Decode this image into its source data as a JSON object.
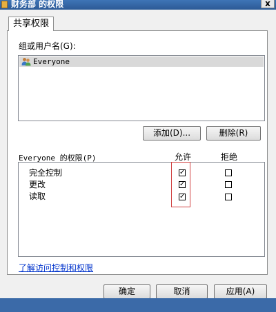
{
  "window": {
    "title": "财务部 的权限",
    "close_glyph": "x"
  },
  "tabs": [
    {
      "label": "共享权限"
    }
  ],
  "group_users": {
    "label": "组或用户名(G):",
    "items": [
      {
        "name": "Everyone",
        "selected": true
      }
    ]
  },
  "buttons": {
    "add": "添加(D)...",
    "remove": "删除(R)",
    "ok": "确定",
    "cancel": "取消",
    "apply": "应用(A)"
  },
  "permissions": {
    "header_label": "Everyone 的权限(P)",
    "allow_header": "允许",
    "deny_header": "拒绝",
    "rows": [
      {
        "name": "完全控制",
        "allow": true,
        "deny": false
      },
      {
        "name": "更改",
        "allow": true,
        "deny": false
      },
      {
        "name": "读取",
        "allow": true,
        "deny": false
      }
    ]
  },
  "link": {
    "text": "了解访问控制和权限"
  },
  "colors": {
    "accent": "#0033cc",
    "highlight": "#d04040"
  }
}
